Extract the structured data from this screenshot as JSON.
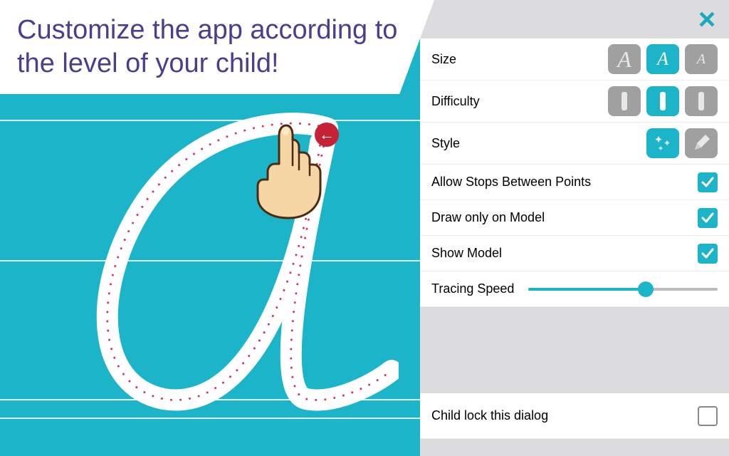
{
  "banner": {
    "text": "Customize the app according to the level of your child!"
  },
  "tracing": {
    "letter": "a",
    "arrow_direction": "left"
  },
  "settings": {
    "size": {
      "label": "Size",
      "options": [
        "large",
        "medium",
        "small"
      ],
      "selected": 1
    },
    "difficulty": {
      "label": "Difficulty",
      "options": [
        "easy",
        "medium",
        "hard"
      ],
      "selected": 1
    },
    "style": {
      "label": "Style",
      "options": [
        "sparkle",
        "pencil"
      ],
      "selected": 0
    },
    "allow_stops": {
      "label": "Allow Stops Between Points",
      "checked": true
    },
    "draw_on_model": {
      "label": "Draw only on Model",
      "checked": true
    },
    "show_model": {
      "label": "Show Model",
      "checked": true
    },
    "tracing_speed": {
      "label": "Tracing Speed",
      "value": 0.62
    },
    "child_lock": {
      "label": "Child lock this dialog",
      "checked": false
    }
  },
  "icons": {
    "close": "×",
    "arrow_left": "←"
  }
}
